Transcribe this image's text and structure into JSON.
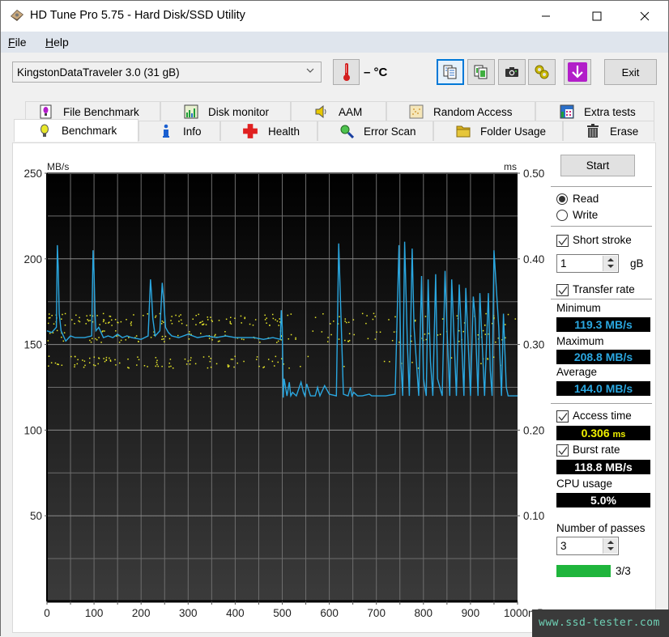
{
  "window": {
    "title": "HD Tune Pro 5.75 - Hard Disk/SSD Utility",
    "controls": {
      "minimize": "minimize-icon",
      "maximize": "maximize-icon",
      "close": "close-icon"
    }
  },
  "menu": {
    "items": [
      {
        "label": "File",
        "mnemonic": "F",
        "rest": "ile"
      },
      {
        "label": "Help",
        "mnemonic": "H",
        "rest": "elp"
      }
    ]
  },
  "toolbar": {
    "drive": "KingstonDataTraveler 3.0 (31 gB)",
    "temperature": "– °C",
    "buttons": [
      {
        "name": "copy-text",
        "icon": "copy-text-icon",
        "active": true
      },
      {
        "name": "copy-screenshot",
        "icon": "copy-image-icon",
        "active": false
      },
      {
        "name": "screenshot",
        "icon": "camera-icon",
        "active": false
      },
      {
        "name": "options",
        "icon": "gears-icon",
        "active": false
      },
      {
        "name": "save",
        "icon": "download-arrow-icon",
        "active": false
      }
    ],
    "exit_label": "Exit"
  },
  "tabs": {
    "row1": [
      {
        "label": "File Benchmark",
        "icon": "file-benchmark-icon"
      },
      {
        "label": "Disk monitor",
        "icon": "disk-monitor-icon"
      },
      {
        "label": "AAM",
        "icon": "speaker-icon"
      },
      {
        "label": "Random Access",
        "icon": "random-access-icon"
      },
      {
        "label": "Extra tests",
        "icon": "extra-tests-icon"
      }
    ],
    "row2": [
      {
        "label": "Benchmark",
        "icon": "lightbulb-icon",
        "selected": true
      },
      {
        "label": "Info",
        "icon": "info-icon"
      },
      {
        "label": "Health",
        "icon": "health-cross-icon"
      },
      {
        "label": "Error Scan",
        "icon": "magnifier-icon"
      },
      {
        "label": "Folder Usage",
        "icon": "folder-icon"
      },
      {
        "label": "Erase",
        "icon": "trash-icon"
      }
    ]
  },
  "side": {
    "start_label": "Start",
    "mode": {
      "read": "Read",
      "write": "Write",
      "selected": "Read"
    },
    "short_stroke": {
      "label": "Short stroke",
      "checked": true,
      "value": "1",
      "unit": "gB"
    },
    "transfer_rate": {
      "label": "Transfer rate",
      "checked": true
    },
    "minimum": {
      "label": "Minimum",
      "value": "119.3 MB/s"
    },
    "maximum": {
      "label": "Maximum",
      "value": "208.8 MB/s"
    },
    "average": {
      "label": "Average",
      "value": "144.0 MB/s"
    },
    "access_time": {
      "label": "Access time",
      "checked": true,
      "value": "0.306",
      "unit": "ms"
    },
    "burst_rate": {
      "label": "Burst rate",
      "checked": true,
      "value": "118.8 MB/s"
    },
    "cpu_usage": {
      "label": "CPU usage",
      "value": "5.0%"
    },
    "passes": {
      "label": "Number of passes",
      "value": "3",
      "progress_text": "3/3",
      "progress_fraction": 1.0
    }
  },
  "colors": {
    "transfer_line": "#2aa7e0",
    "access_dots": "#e8e82a",
    "plot_top": "#000000",
    "plot_bottom": "#3a3a3a",
    "grid": "#6e6e6e",
    "readout_blue": "#2aa7e0",
    "readout_yellow": "#f1f100",
    "progress": "#1fb53c"
  },
  "watermark": "www.ssd-tester.com",
  "chart_data": {
    "type": "line",
    "title": "",
    "xlabel": "mB",
    "ylabel_left": "MB/s",
    "ylabel_right": "ms",
    "xlim": [
      0,
      1000
    ],
    "ylim_left": [
      0,
      250
    ],
    "ylim_right": [
      0,
      0.5
    ],
    "x_ticks": [
      "0",
      "100",
      "200",
      "300",
      "400",
      "500",
      "600",
      "700",
      "800",
      "900",
      "1000mB"
    ],
    "y_ticks_left": [
      "50",
      "100",
      "150",
      "200",
      "250"
    ],
    "y_ticks_right": [
      "0.10",
      "0.20",
      "0.30",
      "0.40",
      "0.50"
    ],
    "grid": true,
    "series": [
      {
        "name": "Transfer rate (MB/s)",
        "axis": "left",
        "x": [
          0,
          10,
          20,
          22,
          24,
          26,
          30,
          35,
          40,
          50,
          60,
          70,
          80,
          95,
          98,
          100,
          102,
          104,
          110,
          120,
          130,
          140,
          150,
          160,
          170,
          180,
          200,
          215,
          220,
          222,
          225,
          230,
          240,
          245,
          248,
          252,
          258,
          265,
          280,
          300,
          320,
          340,
          360,
          380,
          400,
          420,
          440,
          460,
          480,
          496,
          498,
          500,
          502,
          504,
          510,
          515,
          518,
          522,
          530,
          540,
          545,
          548,
          552,
          560,
          570,
          575,
          580,
          590,
          600,
          615,
          620,
          630,
          640,
          645,
          648,
          652,
          660,
          670,
          685,
          690,
          700,
          720,
          740,
          748,
          752,
          756,
          760,
          766,
          770,
          776,
          780,
          790,
          796,
          800,
          806,
          810,
          815,
          820,
          826,
          830,
          840,
          846,
          850,
          856,
          860,
          870,
          876,
          880,
          886,
          890,
          900,
          906,
          910,
          916,
          920,
          930,
          938,
          942,
          946,
          950,
          960,
          966,
          970,
          976,
          980,
          1000
        ],
        "y": [
          158,
          157,
          160,
          208,
          195,
          168,
          158,
          155,
          152,
          155,
          154,
          154,
          154,
          155,
          205,
          192,
          168,
          158,
          160,
          154,
          155,
          154,
          156,
          154,
          155,
          154,
          153,
          155,
          188,
          180,
          165,
          155,
          158,
          186,
          176,
          160,
          157,
          155,
          154,
          156,
          154,
          155,
          154,
          155,
          154,
          154,
          154,
          153,
          154,
          153,
          170,
          160,
          119,
          130,
          120,
          128,
          120,
          122,
          120,
          128,
          122,
          120,
          127,
          120,
          120,
          125,
          120,
          126,
          121,
          120,
          209,
          121,
          120,
          125,
          120,
          122,
          120,
          120,
          121,
          120,
          120,
          120,
          121,
          208,
          140,
          120,
          210,
          150,
          120,
          206,
          160,
          120,
          190,
          130,
          120,
          188,
          140,
          120,
          191,
          130,
          120,
          193,
          160,
          120,
          188,
          120,
          185,
          160,
          120,
          183,
          120,
          178,
          165,
          120,
          180,
          120,
          180,
          135,
          120,
          205,
          160,
          120,
          168,
          125,
          120,
          120
        ]
      },
      {
        "name": "Access time (ms)",
        "axis": "right",
        "style": "scatter",
        "bands_ms": [
          0.33,
          0.31,
          0.28
        ],
        "x_range": [
          0,
          1000
        ],
        "note": "yellow dots clustered around 0.33, 0.31 (150-165 MB/s equiv.) and 0.28 ms (first half); sparse beyond 500 mB"
      }
    ]
  }
}
